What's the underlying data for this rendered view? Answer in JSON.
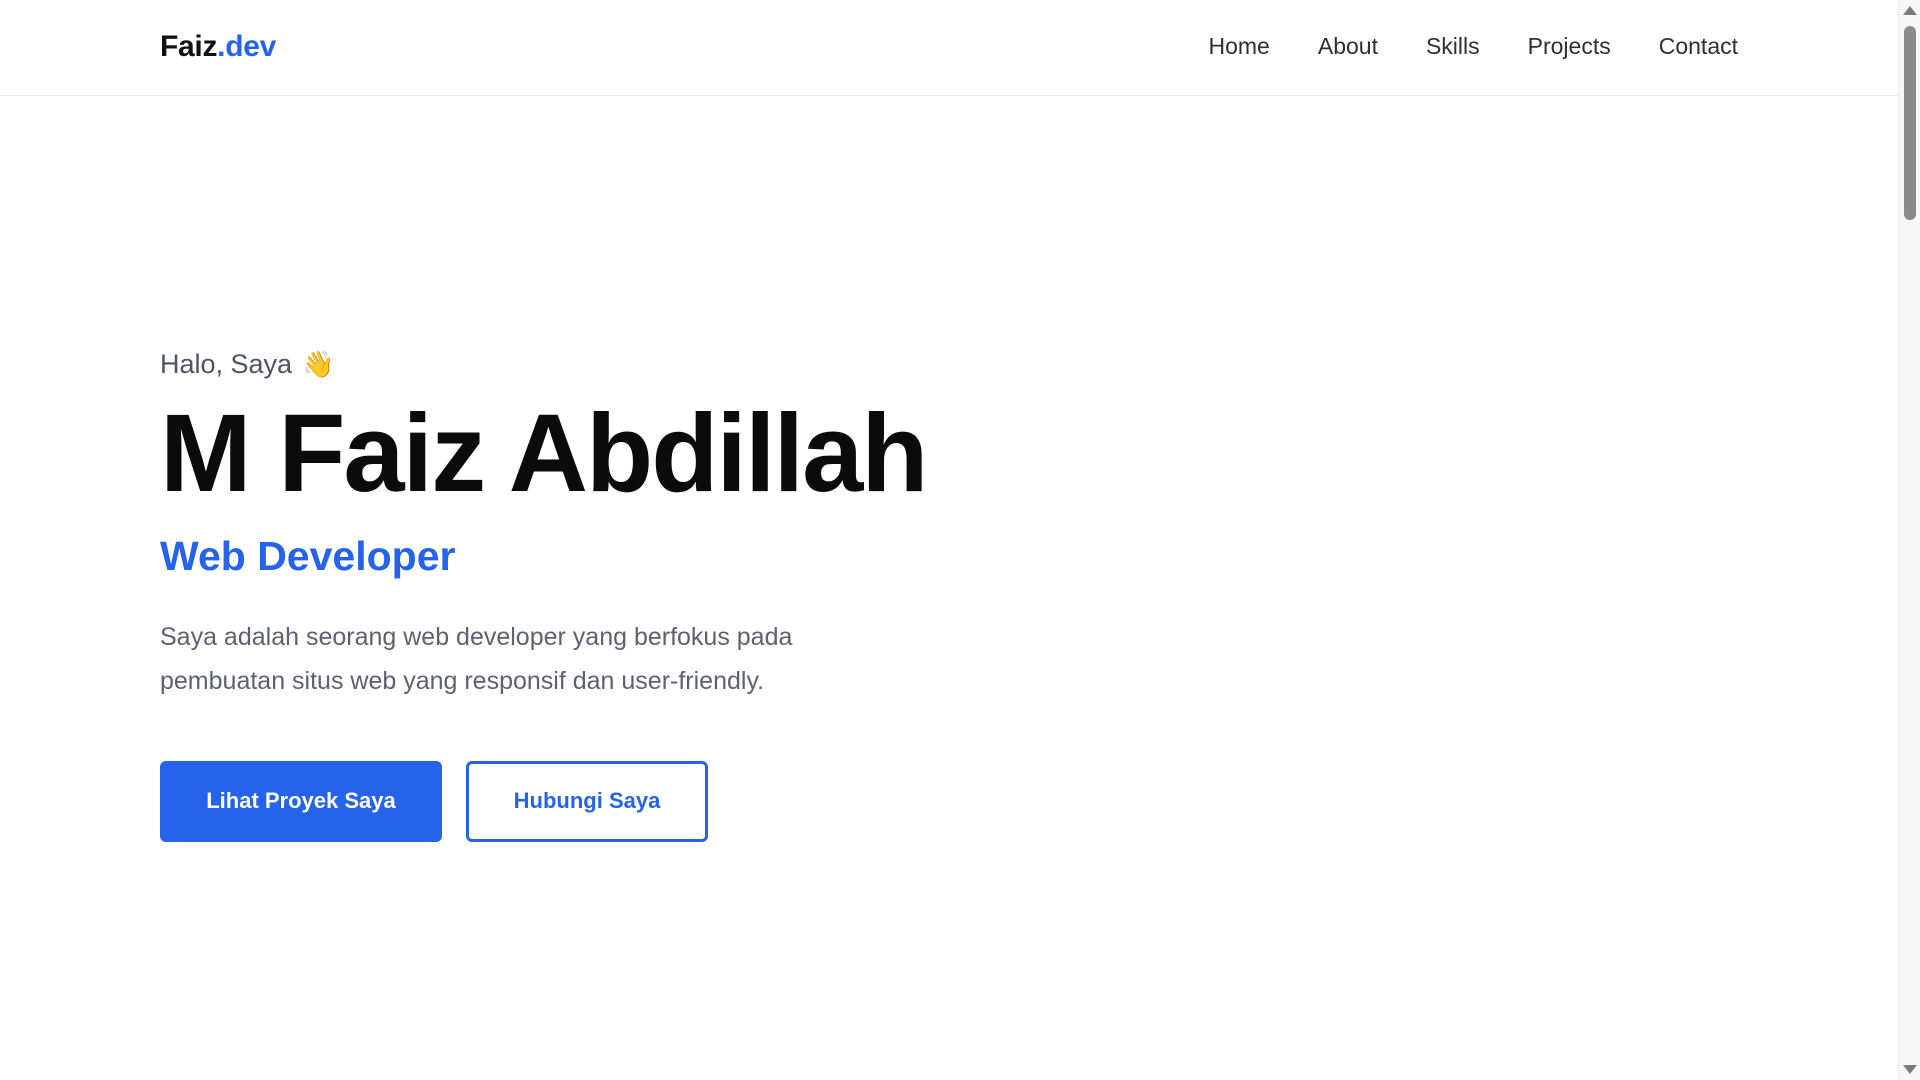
{
  "brand": {
    "name": "Faiz",
    "suffix": ".dev",
    "accent_color": "#2563eb"
  },
  "nav": {
    "items": [
      {
        "label": "Home"
      },
      {
        "label": "About"
      },
      {
        "label": "Skills"
      },
      {
        "label": "Projects"
      },
      {
        "label": "Contact"
      }
    ]
  },
  "hero": {
    "greeting": "Halo, Saya",
    "greeting_icon": "waving-hand-icon",
    "wave_glyph": "👋",
    "name": "M Faiz Abdillah",
    "role": "Web Developer",
    "description": "Saya adalah seorang web developer yang berfokus pada pembuatan situs web yang responsif dan user-friendly.",
    "primary_button": "Lihat Proyek Saya",
    "secondary_button": "Hubungi Saya"
  },
  "colors": {
    "primary": "#2563eb",
    "heading": "#0b0b0b",
    "muted_text": "#5b6270"
  }
}
